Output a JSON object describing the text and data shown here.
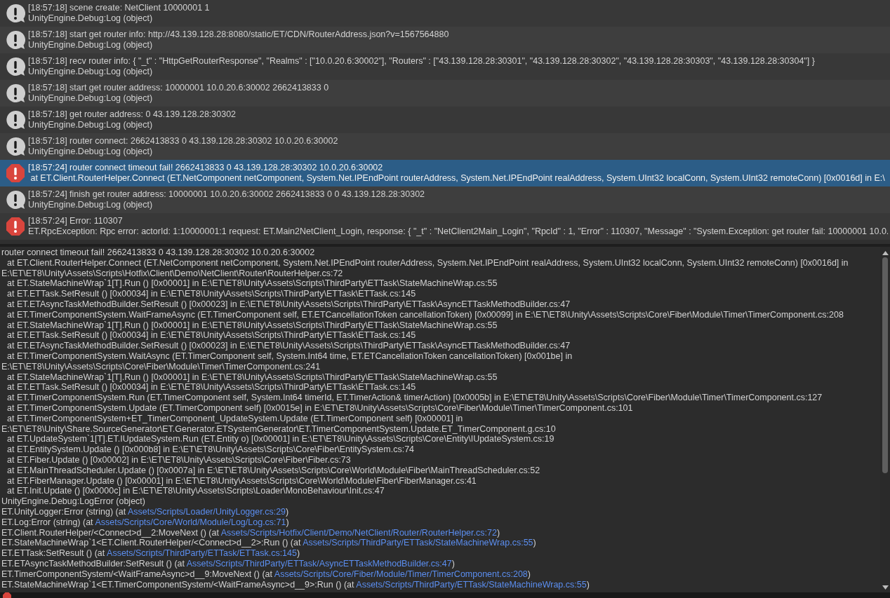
{
  "log_entries": [
    {
      "kind": "info",
      "selected": false,
      "message": "[18:57:18] scene create: NetClient 10000001 1",
      "detail": "UnityEngine.Debug:Log (object)"
    },
    {
      "kind": "info",
      "selected": false,
      "message": "[18:57:18] start get router info: http://43.139.128.28:8080/static/ET/CDN/RouterAddress.json?v=1567564880",
      "detail": "UnityEngine.Debug:Log (object)"
    },
    {
      "kind": "info",
      "selected": false,
      "message": "[18:57:18] recv router info: { \"_t\" : \"HttpGetRouterResponse\", \"Realms\" : [\"10.0.20.6:30002\"], \"Routers\" : [\"43.139.128.28:30301\", \"43.139.128.28:30302\", \"43.139.128.28:30303\", \"43.139.128.28:30304\"] }",
      "detail": "UnityEngine.Debug:Log (object)"
    },
    {
      "kind": "info",
      "selected": false,
      "message": "[18:57:18] start get router address: 10000001 10.0.20.6:30002 2662413833 0",
      "detail": "UnityEngine.Debug:Log (object)"
    },
    {
      "kind": "info",
      "selected": false,
      "message": "[18:57:18] get router address: 0 43.139.128.28:30302",
      "detail": "UnityEngine.Debug:Log (object)"
    },
    {
      "kind": "info",
      "selected": false,
      "message": "[18:57:18] router connect: 2662413833 0 43.139.128.28:30302 10.0.20.6:30002",
      "detail": "UnityEngine.Debug:Log (object)"
    },
    {
      "kind": "error",
      "selected": true,
      "message": "[18:57:24] router connect timeout fail! 2662413833 0 43.139.128.28:30302 10.0.20.6:30002",
      "detail": " at ET.Client.RouterHelper.Connect (ET.NetComponent netComponent, System.Net.IPEndPoint routerAddress, System.Net.IPEndPoint realAddress, System.UInt32 localConn, System.UInt32 remoteConn) [0x0016d] in E:\\"
    },
    {
      "kind": "info",
      "selected": false,
      "message": "[18:57:24] finish get router address: 10000001 10.0.20.6:30002 2662413833 0 0 43.139.128.28:30302",
      "detail": "UnityEngine.Debug:Log (object)"
    },
    {
      "kind": "error",
      "selected": false,
      "message": "[18:57:24] Error: 110307",
      "detail": "ET.RpcException: Rpc error: actorId: 1:10000001:1 request: ET.Main2NetClient_Login, response: { \"_t\" : \"NetClient2Main_Login\", \"RpcId\" : 1, \"Error\" : 110307, \"Message\" : \"System.Exception: get router fail: 10000001 10.0."
    }
  ],
  "detail": {
    "lines": [
      {
        "kind": "plain",
        "text": "router connect timeout fail! 2662413833 0 43.139.128.28:30302 10.0.20.6:30002"
      },
      {
        "kind": "frame",
        "text": "at ET.Client.RouterHelper.Connect (ET.NetComponent netComponent, System.Net.IPEndPoint routerAddress, System.Net.IPEndPoint realAddress, System.UInt32 localConn, System.UInt32 remoteConn) [0x0016d] in"
      },
      {
        "kind": "plain",
        "text": "E:\\ET\\ET8\\Unity\\Assets\\Scripts\\Hotfix\\Client\\Demo\\NetClient\\Router\\RouterHelper.cs:72"
      },
      {
        "kind": "frame",
        "text": "at ET.StateMachineWrap`1[T].Run () [0x00001] in E:\\ET\\ET8\\Unity\\Assets\\Scripts\\ThirdParty\\ETTask\\StateMachineWrap.cs:55"
      },
      {
        "kind": "frame",
        "text": "at ET.ETTask.SetResult () [0x00034] in E:\\ET\\ET8\\Unity\\Assets\\Scripts\\ThirdParty\\ETTask\\ETTask.cs:145"
      },
      {
        "kind": "frame",
        "text": "at ET.ETAsyncTaskMethodBuilder.SetResult () [0x00023] in E:\\ET\\ET8\\Unity\\Assets\\Scripts\\ThirdParty\\ETTask\\AsyncETTaskMethodBuilder.cs:47"
      },
      {
        "kind": "frame",
        "text": "at ET.TimerComponentSystem.WaitFrameAsync (ET.TimerComponent self, ET.ETCancellationToken cancellationToken) [0x00099] in E:\\ET\\ET8\\Unity\\Assets\\Scripts\\Core\\Fiber\\Module\\Timer\\TimerComponent.cs:208"
      },
      {
        "kind": "frame",
        "text": "at ET.StateMachineWrap`1[T].Run () [0x00001] in E:\\ET\\ET8\\Unity\\Assets\\Scripts\\ThirdParty\\ETTask\\StateMachineWrap.cs:55"
      },
      {
        "kind": "frame",
        "text": "at ET.ETTask.SetResult () [0x00034] in E:\\ET\\ET8\\Unity\\Assets\\Scripts\\ThirdParty\\ETTask\\ETTask.cs:145"
      },
      {
        "kind": "frame",
        "text": "at ET.ETAsyncTaskMethodBuilder.SetResult () [0x00023] in E:\\ET\\ET8\\Unity\\Assets\\Scripts\\ThirdParty\\ETTask\\AsyncETTaskMethodBuilder.cs:47"
      },
      {
        "kind": "frame",
        "text": "at ET.TimerComponentSystem.WaitAsync (ET.TimerComponent self, System.Int64 time, ET.ETCancellationToken cancellationToken) [0x001be] in"
      },
      {
        "kind": "plain",
        "text": "E:\\ET\\ET8\\Unity\\Assets\\Scripts\\Core\\Fiber\\Module\\Timer\\TimerComponent.cs:241"
      },
      {
        "kind": "frame",
        "text": "at ET.StateMachineWrap`1[T].Run () [0x00001] in E:\\ET\\ET8\\Unity\\Assets\\Scripts\\ThirdParty\\ETTask\\StateMachineWrap.cs:55"
      },
      {
        "kind": "frame",
        "text": "at ET.ETTask.SetResult () [0x00034] in E:\\ET\\ET8\\Unity\\Assets\\Scripts\\ThirdParty\\ETTask\\ETTask.cs:145"
      },
      {
        "kind": "frame",
        "text": "at ET.TimerComponentSystem.Run (ET.TimerComponent self, System.Int64 timerId, ET.TimerAction& timerAction) [0x0005b] in E:\\ET\\ET8\\Unity\\Assets\\Scripts\\Core\\Fiber\\Module\\Timer\\TimerComponent.cs:127"
      },
      {
        "kind": "frame",
        "text": "at ET.TimerComponentSystem.Update (ET.TimerComponent self) [0x0015e] in E:\\ET\\ET8\\Unity\\Assets\\Scripts\\Core\\Fiber\\Module\\Timer\\TimerComponent.cs:101"
      },
      {
        "kind": "frame",
        "text": "at ET.TimerComponentSystem+ET_TimerComponent_UpdateSystem.Update (ET.TimerComponent self) [0x00001] in"
      },
      {
        "kind": "plain",
        "text": "E:\\ET\\ET8\\Unity\\Share.SourceGenerator\\ET.Generator.ETSystemGenerator\\ET.TimerComponentSystem.Update.ET_TimerComponent.g.cs:10"
      },
      {
        "kind": "frame",
        "text": "at ET.UpdateSystem`1[T].ET.IUpdateSystem.Run (ET.Entity o) [0x00001] in E:\\ET\\ET8\\Unity\\Assets\\Scripts\\Core\\Entity\\IUpdateSystem.cs:19"
      },
      {
        "kind": "frame",
        "text": "at ET.EntitySystem.Update () [0x000b8] in E:\\ET\\ET8\\Unity\\Assets\\Scripts\\Core\\Fiber\\EntitySystem.cs:74"
      },
      {
        "kind": "frame",
        "text": "at ET.Fiber.Update () [0x00002] in E:\\ET\\ET8\\Unity\\Assets\\Scripts\\Core\\Fiber\\Fiber.cs:73"
      },
      {
        "kind": "frame",
        "text": "at ET.MainThreadScheduler.Update () [0x0007a] in E:\\ET\\ET8\\Unity\\Assets\\Scripts\\Core\\World\\Module\\Fiber\\MainThreadScheduler.cs:52"
      },
      {
        "kind": "frame",
        "text": "at ET.FiberManager.Update () [0x00001] in E:\\ET\\ET8\\Unity\\Assets\\Scripts\\Core\\World\\Module\\Fiber\\FiberManager.cs:41"
      },
      {
        "kind": "frame",
        "text": "at ET.Init.Update () [0x0000c] in E:\\ET\\ET8\\Unity\\Assets\\Scripts\\Loader\\MonoBehaviour\\Init.cs:47"
      },
      {
        "kind": "plain",
        "text": "UnityEngine.Debug:LogError (object)"
      },
      {
        "kind": "link",
        "text": "ET.UnityLogger:Error (string) (at ",
        "link": "Assets/Scripts/Loader/UnityLogger.cs:29",
        "suffix": ")"
      },
      {
        "kind": "link",
        "text": "ET.Log:Error (string) (at ",
        "link": "Assets/Scripts/Core/World/Module/Log/Log.cs:71",
        "suffix": ")"
      },
      {
        "kind": "link",
        "text": "ET.Client.RouterHelper/<Connect>d__2:MoveNext () (at ",
        "link": "Assets/Scripts/Hotfix/Client/Demo/NetClient/Router/RouterHelper.cs:72",
        "suffix": ")"
      },
      {
        "kind": "link",
        "text": "ET.StateMachineWrap`1<ET.Client.RouterHelper/<Connect>d__2>:Run () (at ",
        "link": "Assets/Scripts/ThirdParty/ETTask/StateMachineWrap.cs:55",
        "suffix": ")"
      },
      {
        "kind": "link",
        "text": "ET.ETTask:SetResult () (at ",
        "link": "Assets/Scripts/ThirdParty/ETTask/ETTask.cs:145",
        "suffix": ")"
      },
      {
        "kind": "link",
        "text": "ET.ETAsyncTaskMethodBuilder:SetResult () (at ",
        "link": "Assets/Scripts/ThirdParty/ETTask/AsyncETTaskMethodBuilder.cs:47",
        "suffix": ")"
      },
      {
        "kind": "link",
        "text": "ET.TimerComponentSystem/<WaitFrameAsync>d__9:MoveNext () (at ",
        "link": "Assets/Scripts/Core/Fiber/Module/Timer/TimerComponent.cs:208",
        "suffix": ")"
      },
      {
        "kind": "link",
        "text": "ET.StateMachineWrap`1<ET.TimerComponentSystem/<WaitFrameAsync>d__9>:Run () (at ",
        "link": "Assets/Scripts/ThirdParty/ETTask/StateMachineWrap.cs:55",
        "suffix": ")"
      }
    ]
  }
}
